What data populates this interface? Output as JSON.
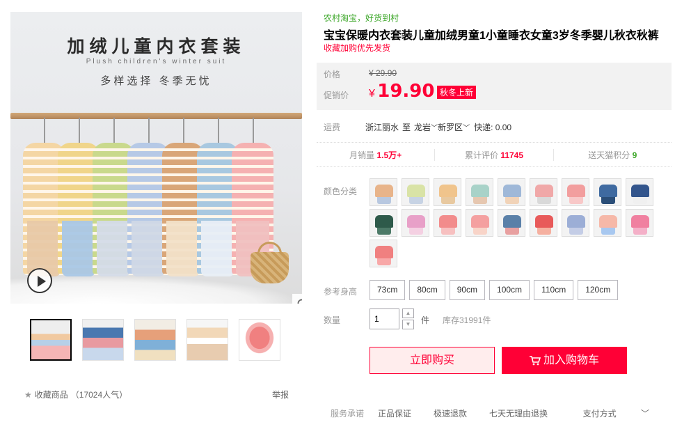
{
  "gallery": {
    "main_title": "加绒儿童内衣套装",
    "main_subtitle": "Plush children's winter suit",
    "main_slogan": "多样选择  冬季无忧",
    "thumbnail_count": 5
  },
  "favorite": {
    "label": "收藏商品",
    "count": "（17024人气）",
    "report": "举报"
  },
  "product": {
    "tag": "农村淘宝，好货到村",
    "title": "宝宝保暖内衣套装儿童加绒男童1小童睡衣女童3岁冬季婴儿秋衣秋裤",
    "subtitle": "收藏加购优先发货"
  },
  "price": {
    "label": "价格",
    "original": "¥ 29.90",
    "promo_label": "促销价",
    "currency": "¥",
    "promo": "19.90",
    "badge": "秋冬上新",
    "accent": "#ff0036"
  },
  "shipping": {
    "label": "运费",
    "from": "浙江丽水",
    "to_word": "至",
    "city": "龙岩",
    "district": "新罗区",
    "fee": "快递: 0.00"
  },
  "stats": {
    "monthly_label": "月销量",
    "monthly_value": "1.5万+",
    "reviews_label": "累计评价",
    "reviews_value": "11745",
    "points_label": "送天猫积分",
    "points_value": "9"
  },
  "color": {
    "label": "颜色分类",
    "swatches": [
      {
        "top": "#e8b48a",
        "bottom": "#b8c8e0"
      },
      {
        "top": "#d9e3a6",
        "bottom": "#c7d3e4"
      },
      {
        "top": "#f0c48c",
        "bottom": "#e8c9a0"
      },
      {
        "top": "#a8d2c8",
        "bottom": "#e6c7b0"
      },
      {
        "top": "#9fb8d8",
        "bottom": "#f1d3b8"
      },
      {
        "top": "#f0a8a8",
        "bottom": "#d9d9d9"
      },
      {
        "top": "#f29e9e",
        "bottom": "#f8c8c8"
      },
      {
        "top": "#3f6aa0",
        "bottom": "#2b4e78"
      },
      {
        "top": "#33558c",
        "bottom": "#f0f0f0"
      },
      {
        "top": "#2e5a4a",
        "bottom": "#4d7a68"
      },
      {
        "top": "#e8a0c8",
        "bottom": "#f4d0e2"
      },
      {
        "top": "#f28c8c",
        "bottom": "#f7c0c0"
      },
      {
        "top": "#f4a0a0",
        "bottom": "#f8d4c8"
      },
      {
        "top": "#5a80a8",
        "bottom": "#e8a0a0"
      },
      {
        "top": "#e85a5a",
        "bottom": "#f5b0a0"
      },
      {
        "top": "#9caed6",
        "bottom": "#c4cde6"
      },
      {
        "top": "#f6b8a8",
        "bottom": "#a8c8f0"
      },
      {
        "top": "#f080a0",
        "bottom": "#f4b0c8"
      },
      {
        "top": "#f08080",
        "bottom": "#f8a8a8"
      }
    ]
  },
  "size": {
    "label": "参考身高",
    "options": [
      "73cm",
      "80cm",
      "90cm",
      "100cm",
      "110cm",
      "120cm"
    ]
  },
  "quantity": {
    "label": "数量",
    "value": "1",
    "unit": "件",
    "stock": "库存31991件"
  },
  "actions": {
    "buy_now": "立即购买",
    "add_cart": "加入购物车"
  },
  "service": {
    "label": "服务承诺",
    "items": [
      "正品保证",
      "极速退款",
      "七天无理由退换"
    ],
    "pay": "支付方式"
  }
}
